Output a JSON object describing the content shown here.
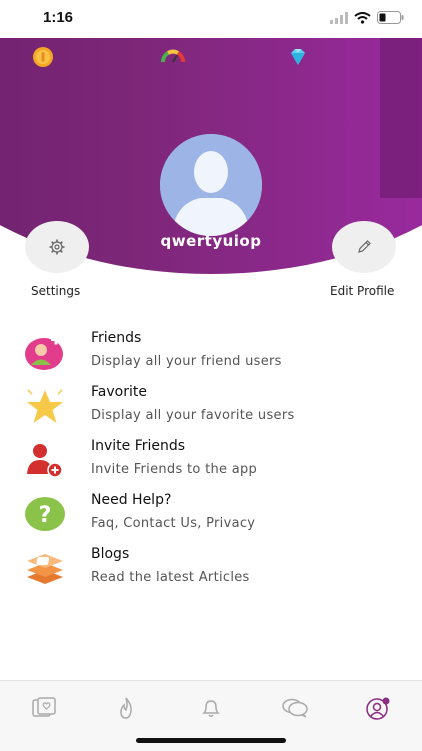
{
  "status": {
    "time": "1:16"
  },
  "profile": {
    "username": "qwertyuiop"
  },
  "actions": {
    "settings_label": "Settings",
    "edit_label": "Edit Profile"
  },
  "menu": [
    {
      "title": "Friends",
      "subtitle": "Display all your friend users",
      "icon": "friends-add-icon"
    },
    {
      "title": "Favorite",
      "subtitle": "Display all your favorite users",
      "icon": "star-icon"
    },
    {
      "title": "Invite Friends",
      "subtitle": "Invite Friends to the app",
      "icon": "invite-user-icon"
    },
    {
      "title": "Need Help?",
      "subtitle": "Faq, Contact Us, Privacy",
      "icon": "help-icon"
    },
    {
      "title": "Blogs",
      "subtitle": "Read the latest Articles",
      "icon": "blogger-icon"
    }
  ],
  "tabs": [
    "cards-icon",
    "flame-icon",
    "bell-icon",
    "chat-icon",
    "profile-icon"
  ],
  "colors": {
    "header_start": "#6a1f6b",
    "header_end": "#a02ea6",
    "active_tab": "#8a2b84"
  }
}
